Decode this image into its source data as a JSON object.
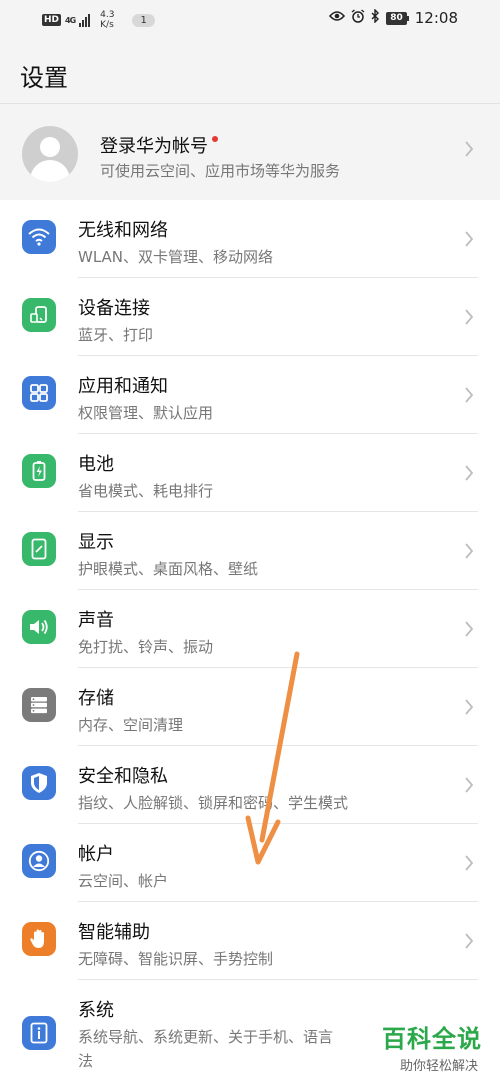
{
  "status_bar": {
    "hd": "HD",
    "network": "4G",
    "speed_value": "4.3",
    "speed_unit": "K/s",
    "notification_count": "1",
    "battery": "80",
    "time": "12:08"
  },
  "page": {
    "title": "设置"
  },
  "account": {
    "title": "登录华为帐号",
    "subtitle": "可使用云空间、应用市场等华为服务"
  },
  "settings": [
    {
      "label": "无线和网络",
      "sub": "WLAN、双卡管理、移动网络",
      "icon": "wifi-icon",
      "color": "#3f7ad8"
    },
    {
      "label": "设备连接",
      "sub": "蓝牙、打印",
      "icon": "device-connect-icon",
      "color": "#38b86a"
    },
    {
      "label": "应用和通知",
      "sub": "权限管理、默认应用",
      "icon": "apps-grid-icon",
      "color": "#3f7ad8"
    },
    {
      "label": "电池",
      "sub": "省电模式、耗电排行",
      "icon": "battery-icon",
      "color": "#38b86a"
    },
    {
      "label": "显示",
      "sub": "护眼模式、桌面风格、壁纸",
      "icon": "display-icon",
      "color": "#38b86a"
    },
    {
      "label": "声音",
      "sub": "免打扰、铃声、振动",
      "icon": "speaker-icon",
      "color": "#38b86a"
    },
    {
      "label": "存储",
      "sub": "内存、空间清理",
      "icon": "storage-icon",
      "color": "#7b7b7b"
    },
    {
      "label": "安全和隐私",
      "sub": "指纹、人脸解锁、锁屏和密码、学生模式",
      "icon": "shield-icon",
      "color": "#3f7ad8"
    },
    {
      "label": "帐户",
      "sub": "云空间、帐户",
      "icon": "account-icon",
      "color": "#3f7ad8"
    },
    {
      "label": "智能辅助",
      "sub": "无障碍、智能识屏、手势控制",
      "icon": "hand-icon",
      "color": "#ee7f2a"
    },
    {
      "label": "系统",
      "sub": "系统导航、系统更新、关于手机、语言",
      "sub2": "法",
      "icon": "system-info-icon",
      "color": "#3f7ad8"
    }
  ],
  "watermark": {
    "title": "百科全说",
    "subtitle": "助你轻松解决"
  }
}
